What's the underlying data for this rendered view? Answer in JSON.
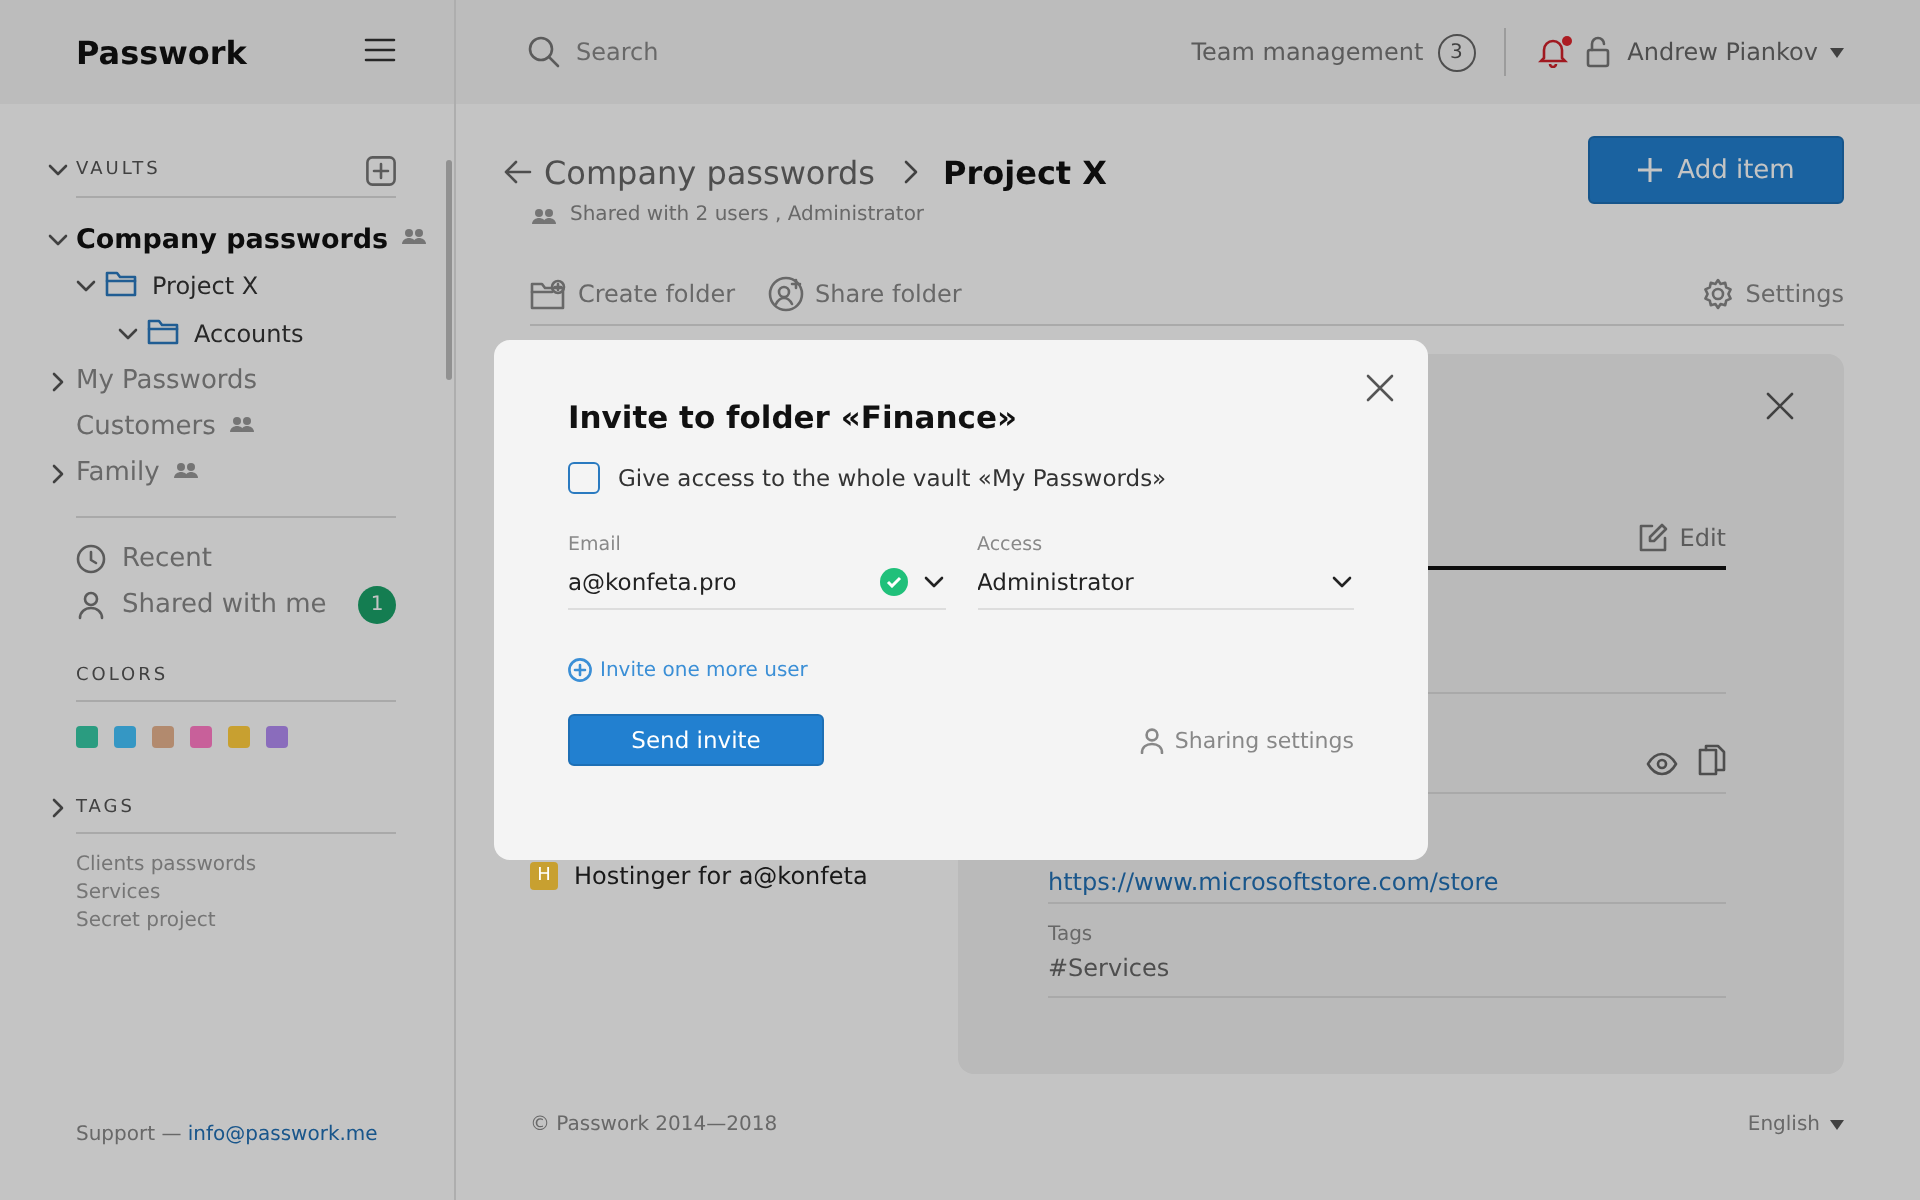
{
  "sidebar": {
    "logo": "Passwork",
    "vaults_heading": "VAULTS",
    "vaults": [
      {
        "name": "Company passwords",
        "shared": true,
        "collapsible": true,
        "expanded": true,
        "selected": true,
        "children": [
          {
            "name": "Project X",
            "collapsible": true,
            "expanded": true,
            "selected": false,
            "children": [
              {
                "name": "Accounts",
                "collapsible": true,
                "expanded": true,
                "selected": false
              }
            ]
          }
        ]
      },
      {
        "name": "My Passwords",
        "shared": false,
        "collapsible": true,
        "expanded": false,
        "selected": false
      },
      {
        "name": "Customers",
        "shared": true,
        "collapsible": false,
        "selected": false
      },
      {
        "name": "Family",
        "shared": true,
        "collapsible": true,
        "expanded": false,
        "selected": false
      }
    ],
    "links": [
      {
        "kind": "recent",
        "label": "Recent"
      },
      {
        "kind": "shared",
        "label": "Shared with me",
        "badge": "1"
      }
    ],
    "colors_heading": "COLORS",
    "colors": [
      {
        "color": "#2a9c80"
      },
      {
        "color": "#3597c4"
      },
      {
        "color": "#b28a6e"
      },
      {
        "color": "#c8609a"
      },
      {
        "color": "#c8a030"
      },
      {
        "color": "#8a6cbc"
      }
    ],
    "tags_heading": "TAGS",
    "tags_expanded": false,
    "tags": [
      "Clients passwords",
      "Services",
      "Secret project"
    ],
    "support_label": "Support —",
    "support_email": "info@passwork.me"
  },
  "header": {
    "search_placeholder": "Search",
    "team_management": "Team management",
    "team_count": "3",
    "notifications_unread": true,
    "user": "Andrew Piankov"
  },
  "main": {
    "breadcrumb_parent": "Company passwords",
    "breadcrumb_current": "Project X",
    "shared_info": "Shared with 2 users , Administrator",
    "add_button": "Add item",
    "toolbar": {
      "create_folder": "Create folder",
      "share_folder": "Share folder",
      "settings": "Settings"
    },
    "items": [
      {
        "letter": "H",
        "color": "#c8a030",
        "title": "Hostinger for a@konfeta"
      }
    ],
    "detail": {
      "edit": "Edit",
      "url": "https://www.microsoftstore.com/store",
      "tags_label": "Tags",
      "tags_value": "#Services"
    },
    "footer": {
      "copyright": "© Passwork 2014—2018",
      "language": "English"
    }
  },
  "modal": {
    "title": "Invite to folder «Finance»",
    "whole_vault": {
      "label": "Give access to the whole vault «My Passwords»",
      "checked": false
    },
    "email": {
      "label": "Email",
      "value": "a@konfeta.pro",
      "valid": true
    },
    "access": {
      "label": "Access",
      "value": "Administrator"
    },
    "invite_more": "Invite one more user",
    "send": "Send invite",
    "sharing_settings": "Sharing settings"
  }
}
